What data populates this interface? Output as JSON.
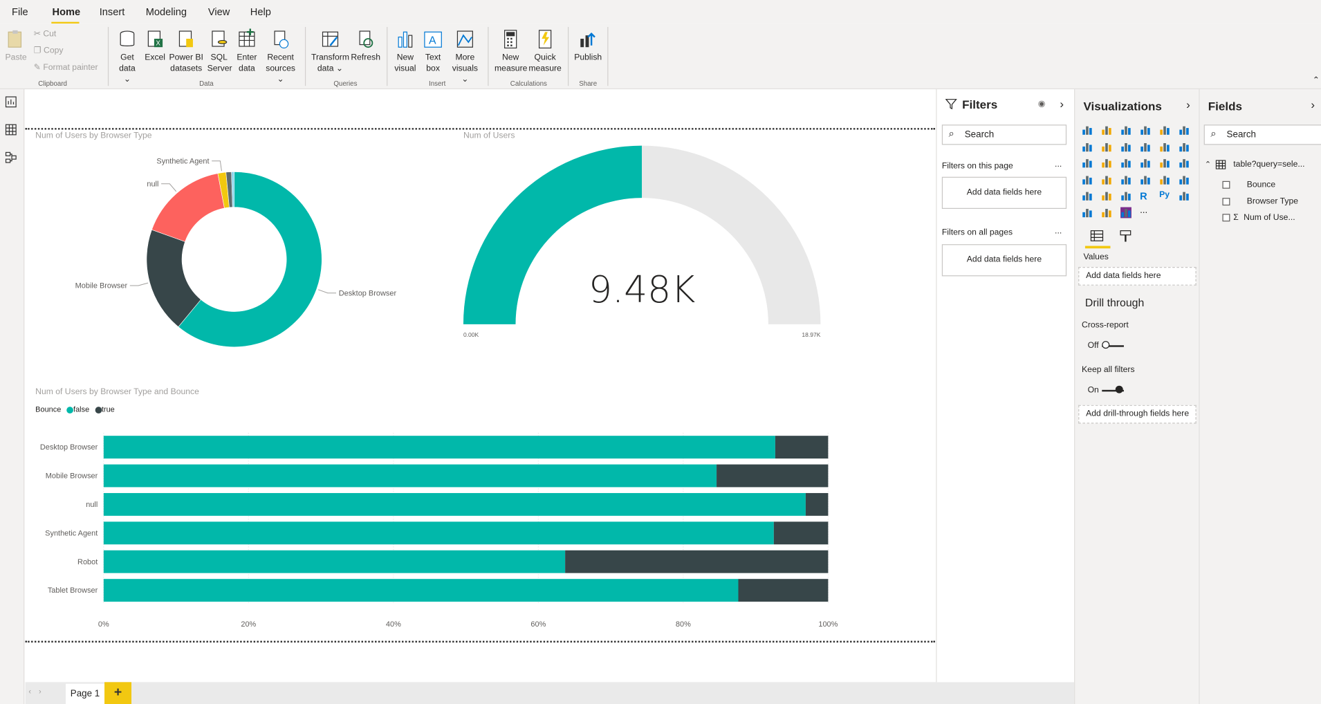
{
  "menu": {
    "tabs": [
      "File",
      "Home",
      "Insert",
      "Modeling",
      "View",
      "Help"
    ]
  },
  "ribbon": {
    "clipboard": {
      "paste": "Paste",
      "cut": "Cut",
      "copy": "Copy",
      "format_painter": "Format painter",
      "group": "Clipboard"
    },
    "data": {
      "get_data": "Get data",
      "excel": "Excel",
      "pbi1": "Power BI",
      "pbi2": "datasets",
      "sql1": "SQL",
      "sql2": "Server",
      "enter1": "Enter",
      "enter2": "data",
      "recent1": "Recent",
      "recent2": "sources",
      "group": "Data"
    },
    "queries": {
      "transform1": "Transform",
      "transform2": "data",
      "refresh": "Refresh",
      "group": "Queries"
    },
    "insert": {
      "newvis1": "New",
      "newvis2": "visual",
      "textbox1": "Text",
      "textbox2": "box",
      "more1": "More",
      "more2": "visuals",
      "group": "Insert"
    },
    "calc": {
      "newm1": "New",
      "newm2": "measure",
      "quick1": "Quick",
      "quick2": "measure",
      "group": "Calculations"
    },
    "share": {
      "publish": "Publish",
      "group": "Share"
    }
  },
  "visuals": {
    "donut_title": "Num of Users by Browser Type",
    "gauge_title": "Num of Users",
    "bar_title": "Num of Users by Browser Type and Bounce"
  },
  "chart_data": [
    {
      "type": "pie",
      "title": "Num of Users by Browser Type",
      "categories": [
        "Desktop Browser",
        "Mobile Browser",
        "null",
        "Synthetic Agent",
        "Robot",
        "Tablet Browser"
      ],
      "values": [
        0.61,
        0.195,
        0.165,
        0.015,
        0.01,
        0.005
      ],
      "colors": [
        "#01b8aa",
        "#374649",
        "#fd625e",
        "#f2c80f",
        "#5f6b6d",
        "#8ad4eb"
      ],
      "labels_shown": [
        "Desktop Browser",
        "Mobile Browser",
        "null",
        "Synthetic Agent"
      ]
    },
    {
      "type": "gauge",
      "title": "Num of Users",
      "value_label": "9.48K",
      "value": 9480,
      "min": 0,
      "max": 18970,
      "min_label": "0.00K",
      "max_label": "18.97K",
      "fill_color": "#01b8aa",
      "track_color": "#e8e8e8"
    },
    {
      "type": "bar",
      "title": "Num of Users by Browser Type and Bounce",
      "stacked_percent": true,
      "legend_title": "Bounce",
      "categories": [
        "Desktop Browser",
        "Mobile Browser",
        "null",
        "Synthetic Agent",
        "Robot",
        "Tablet Browser"
      ],
      "series": [
        {
          "name": "false",
          "color": "#01b8aa",
          "values": [
            92.7,
            84.6,
            96.9,
            92.5,
            63.7,
            87.6
          ]
        },
        {
          "name": "true",
          "color": "#374649",
          "values": [
            7.3,
            15.4,
            3.1,
            7.5,
            36.3,
            12.4
          ]
        }
      ],
      "xticks": [
        "0%",
        "20%",
        "40%",
        "60%",
        "80%",
        "100%"
      ],
      "xlim": [
        0,
        100
      ]
    }
  ],
  "filters": {
    "title": "Filters",
    "search": "Search",
    "on_page": "Filters on this page",
    "on_all": "Filters on all pages",
    "add": "Add data fields here",
    "more": "..."
  },
  "viz_pane": {
    "title": "Visualizations",
    "values": "Values",
    "add_values": "Add data fields here",
    "drill": "Drill through",
    "cross": "Cross-report",
    "off": "Off",
    "keep": "Keep all filters",
    "on": "On",
    "add_drill": "Add drill-through fields here",
    "more": "..."
  },
  "fields_pane": {
    "title": "Fields",
    "search": "Search",
    "table": "table?query=sele...",
    "fields": [
      "Bounce",
      "Browser Type",
      "Num of Use..."
    ]
  },
  "pages": {
    "page1": "Page 1",
    "add": "+"
  }
}
